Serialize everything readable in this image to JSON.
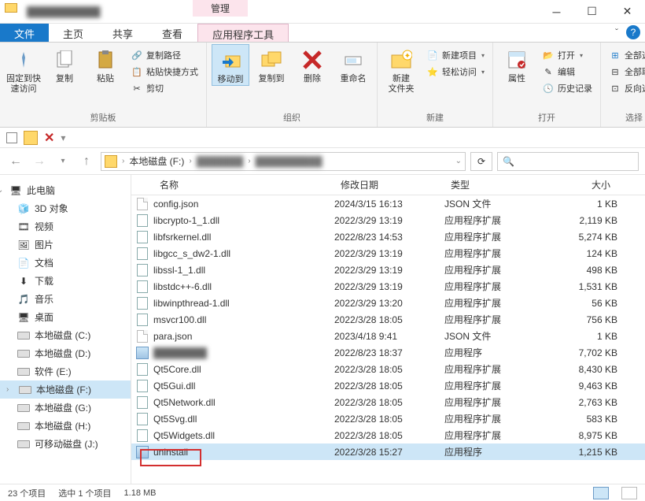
{
  "titlebar": {
    "manage_tab": "管理"
  },
  "tabs": {
    "file": "文件",
    "home": "主页",
    "share": "共享",
    "view": "查看",
    "app_tools": "应用程序工具"
  },
  "ribbon": {
    "pin_quick": "固定到快\n速访问",
    "copy": "复制",
    "paste": "粘贴",
    "copy_path": "复制路径",
    "paste_shortcut": "粘贴快捷方式",
    "cut": "剪切",
    "clipboard_group": "剪贴板",
    "move_to": "移动到",
    "copy_to": "复制到",
    "delete": "删除",
    "rename": "重命名",
    "organize_group": "组织",
    "new_folder": "新建\n文件夹",
    "new_item": "新建项目",
    "easy_access": "轻松访问",
    "new_group": "新建",
    "properties": "属性",
    "open": "打开",
    "edit": "编辑",
    "history": "历史记录",
    "open_group": "打开",
    "select_all": "全部选择",
    "select_none": "全部取消",
    "invert_sel": "反向选择",
    "select_group": "选择"
  },
  "address": {
    "root": "本地磁盘 (F:)"
  },
  "sidebar": {
    "this_pc": "此电脑",
    "items": [
      {
        "label": "3D 对象"
      },
      {
        "label": "视频"
      },
      {
        "label": "图片"
      },
      {
        "label": "文档"
      },
      {
        "label": "下载"
      },
      {
        "label": "音乐"
      },
      {
        "label": "桌面"
      },
      {
        "label": "本地磁盘 (C:)"
      },
      {
        "label": "本地磁盘 (D:)"
      },
      {
        "label": "软件 (E:)"
      },
      {
        "label": "本地磁盘 (F:)"
      },
      {
        "label": "本地磁盘 (G:)"
      },
      {
        "label": "本地磁盘 (H:)"
      },
      {
        "label": "可移动磁盘 (J:)"
      }
    ]
  },
  "columns": {
    "name": "名称",
    "date": "修改日期",
    "type": "类型",
    "size": "大小"
  },
  "files": [
    {
      "name": "config.json",
      "date": "2024/3/15 16:13",
      "type": "JSON 文件",
      "size": "1 KB",
      "icon": "json"
    },
    {
      "name": "libcrypto-1_1.dll",
      "date": "2022/3/29 13:19",
      "type": "应用程序扩展",
      "size": "2,119 KB",
      "icon": "dll"
    },
    {
      "name": "libfsrkernel.dll",
      "date": "2022/8/23 14:53",
      "type": "应用程序扩展",
      "size": "5,274 KB",
      "icon": "dll"
    },
    {
      "name": "libgcc_s_dw2-1.dll",
      "date": "2022/3/29 13:19",
      "type": "应用程序扩展",
      "size": "124 KB",
      "icon": "dll"
    },
    {
      "name": "libssl-1_1.dll",
      "date": "2022/3/29 13:19",
      "type": "应用程序扩展",
      "size": "498 KB",
      "icon": "dll"
    },
    {
      "name": "libstdc++-6.dll",
      "date": "2022/3/29 13:19",
      "type": "应用程序扩展",
      "size": "1,531 KB",
      "icon": "dll"
    },
    {
      "name": "libwinpthread-1.dll",
      "date": "2022/3/29 13:20",
      "type": "应用程序扩展",
      "size": "56 KB",
      "icon": "dll"
    },
    {
      "name": "msvcr100.dll",
      "date": "2022/3/28 18:05",
      "type": "应用程序扩展",
      "size": "756 KB",
      "icon": "dll"
    },
    {
      "name": "para.json",
      "date": "2023/4/18 9:41",
      "type": "JSON 文件",
      "size": "1 KB",
      "icon": "json"
    },
    {
      "name": "████████",
      "date": "2022/8/23 18:37",
      "type": "应用程序",
      "size": "7,702 KB",
      "icon": "exe",
      "blur": true
    },
    {
      "name": "Qt5Core.dll",
      "date": "2022/3/28 18:05",
      "type": "应用程序扩展",
      "size": "8,430 KB",
      "icon": "dll"
    },
    {
      "name": "Qt5Gui.dll",
      "date": "2022/3/28 18:05",
      "type": "应用程序扩展",
      "size": "9,463 KB",
      "icon": "dll"
    },
    {
      "name": "Qt5Network.dll",
      "date": "2022/3/28 18:05",
      "type": "应用程序扩展",
      "size": "2,763 KB",
      "icon": "dll"
    },
    {
      "name": "Qt5Svg.dll",
      "date": "2022/3/28 18:05",
      "type": "应用程序扩展",
      "size": "583 KB",
      "icon": "dll"
    },
    {
      "name": "Qt5Widgets.dll",
      "date": "2022/3/28 18:05",
      "type": "应用程序扩展",
      "size": "8,975 KB",
      "icon": "dll"
    },
    {
      "name": "uninstall",
      "date": "2022/3/28 15:27",
      "type": "应用程序",
      "size": "1,215 KB",
      "icon": "exe",
      "selected": true
    }
  ],
  "status": {
    "count": "23 个项目",
    "selected": "选中 1 个项目",
    "size": "1.18 MB"
  }
}
